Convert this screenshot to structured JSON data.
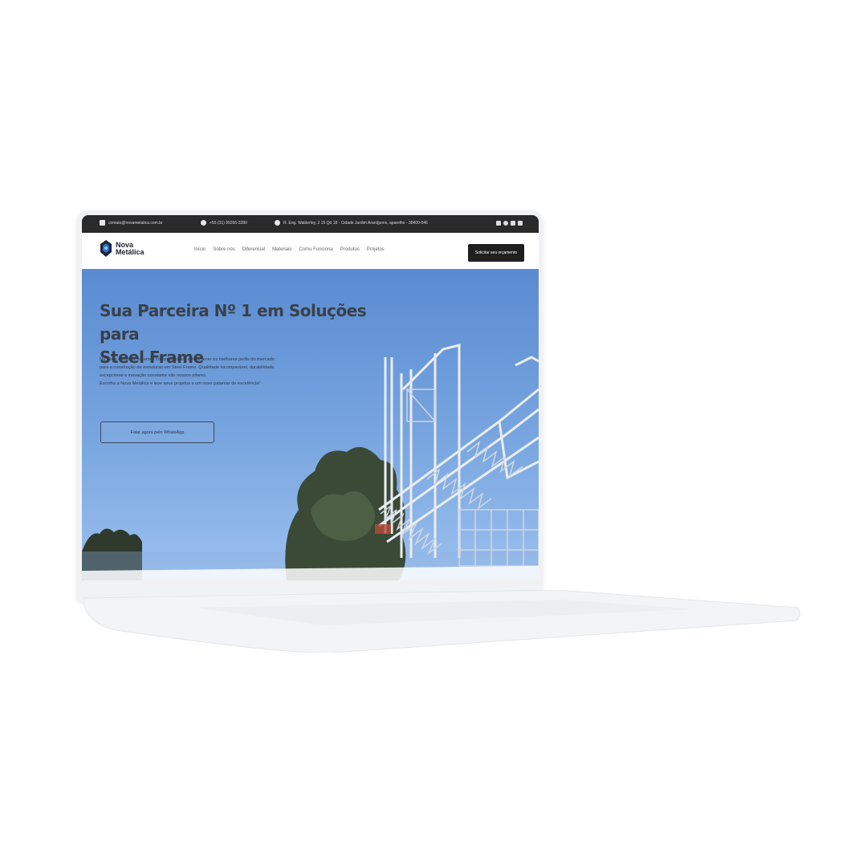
{
  "topbar": {
    "email": "contato@novametalica.com.br",
    "phone": "+55 (31) 99266-3280",
    "address": "R. Eng. Walderley, 2 15 Qd 18 - Cidade Jardim Arani(pons, aparelho - 38400-046",
    "icons": [
      "mail-icon",
      "phone-icon",
      "location-pin-icon"
    ],
    "social_icons": [
      "instagram-icon",
      "facebook-icon",
      "youtube-icon",
      "linkedin-icon"
    ]
  },
  "brand": {
    "name_line1": "Nova",
    "name_line2": "Metálica"
  },
  "nav": {
    "links": [
      "Início",
      "Sobre nós",
      "Diferencial",
      "Materiais",
      "Como Funciona",
      "Produtos",
      "Projetos"
    ],
    "cta_label": "Solicitar seu orçamento"
  },
  "hero": {
    "title_line1": "Sua Parceira Nº 1 em Soluções para",
    "title_line2": "Steel Frame",
    "paragraph_line1": "Na Nova Metálica, estamos comprometidos em fornecer os melhores perfis do mercado",
    "paragraph_line2": "para a construção de estruturas em Steel Frame. Qualidade incomparável, durabilidade",
    "paragraph_line3": "excepcional e inovação constante são nossos pilares.",
    "paragraph_line4": "Escolha a Nova Metálica e leve seus projetos a um novo patamar de excelência!",
    "button_label": "Falar agora pelo WhatsApp"
  },
  "colors": {
    "topbar_bg": "#2a2a2a",
    "cta_bg": "#1f1f1f",
    "sky_top": "#5a8bd1",
    "title_color": "#3a4048"
  }
}
